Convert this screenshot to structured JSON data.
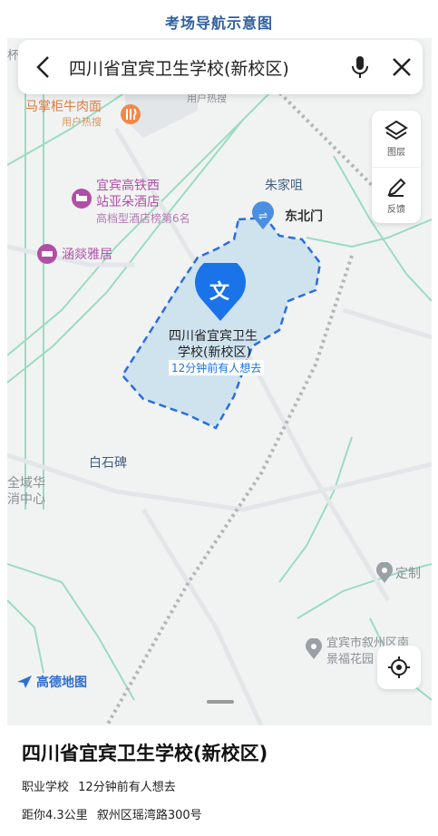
{
  "page": {
    "title": "考场导航示意图"
  },
  "search": {
    "query": "四川省宜宾卫生学校(新校区)"
  },
  "tools": {
    "layers_label": "图层",
    "feedback_label": "反馈"
  },
  "map": {
    "labels": {
      "beef_noodle": "马掌柜牛肉面",
      "beef_noodle_sub": "用户热搜",
      "hotspot": "用户热搜",
      "hotel_line1": "宜宾高铁西",
      "hotel_line2": "站亚朵酒店",
      "hotel_rank": "高档型酒店榜第6名",
      "hanxin": "涵燚雅居",
      "zhujiazui": "朱家咀",
      "north_gate": "东北门",
      "school_line1": "四川省宜宾卫生",
      "school_line2": "学校(新校区)",
      "school_heat": "12分钟前有人想去",
      "school_pin_char": "文",
      "baishibei": "白石碑",
      "quanyu_line1": "全域华",
      "quanyu_line2": "消中心",
      "dingzhi": "定制",
      "yibin_line1": "宜宾市叙州区南",
      "yibin_line2": "景福花园",
      "edge_char": "杯"
    },
    "brand": "高德地图"
  },
  "place": {
    "name": "四川省宜宾卫生学校(新校区)",
    "category": "职业学校",
    "heat": "12分钟前有人想去",
    "distance": "距你4.3公里",
    "address": "叙州区瑶湾路300号"
  },
  "colors": {
    "title": "#2f5f9e",
    "campus_fill": "#cfe3ef",
    "campus_border": "#2a6de0",
    "pin": "#1a73e8",
    "road_green": "#9bdcc0"
  }
}
